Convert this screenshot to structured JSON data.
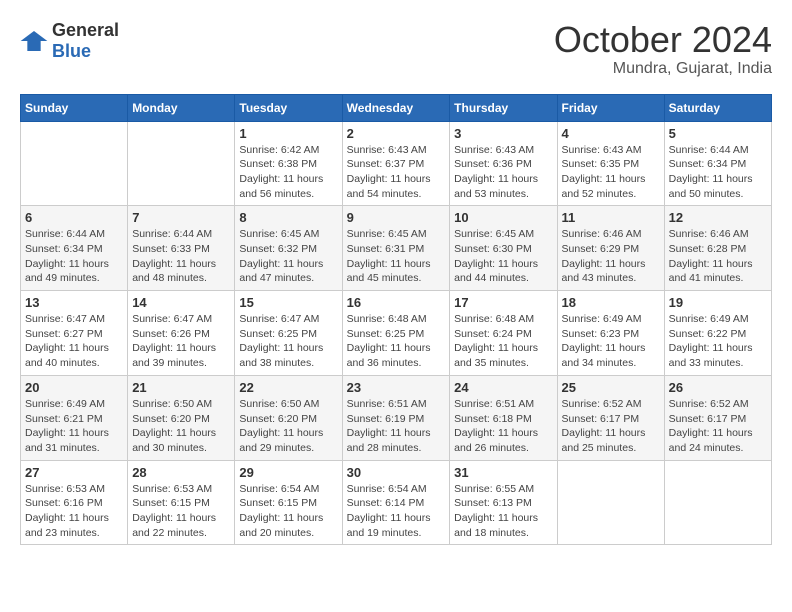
{
  "logo": {
    "general": "General",
    "blue": "Blue"
  },
  "title": "October 2024",
  "location": "Mundra, Gujarat, India",
  "headers": [
    "Sunday",
    "Monday",
    "Tuesday",
    "Wednesday",
    "Thursday",
    "Friday",
    "Saturday"
  ],
  "weeks": [
    [
      {
        "day": "",
        "info": ""
      },
      {
        "day": "",
        "info": ""
      },
      {
        "day": "1",
        "info": "Sunrise: 6:42 AM\nSunset: 6:38 PM\nDaylight: 11 hours and 56 minutes."
      },
      {
        "day": "2",
        "info": "Sunrise: 6:43 AM\nSunset: 6:37 PM\nDaylight: 11 hours and 54 minutes."
      },
      {
        "day": "3",
        "info": "Sunrise: 6:43 AM\nSunset: 6:36 PM\nDaylight: 11 hours and 53 minutes."
      },
      {
        "day": "4",
        "info": "Sunrise: 6:43 AM\nSunset: 6:35 PM\nDaylight: 11 hours and 52 minutes."
      },
      {
        "day": "5",
        "info": "Sunrise: 6:44 AM\nSunset: 6:34 PM\nDaylight: 11 hours and 50 minutes."
      }
    ],
    [
      {
        "day": "6",
        "info": "Sunrise: 6:44 AM\nSunset: 6:34 PM\nDaylight: 11 hours and 49 minutes."
      },
      {
        "day": "7",
        "info": "Sunrise: 6:44 AM\nSunset: 6:33 PM\nDaylight: 11 hours and 48 minutes."
      },
      {
        "day": "8",
        "info": "Sunrise: 6:45 AM\nSunset: 6:32 PM\nDaylight: 11 hours and 47 minutes."
      },
      {
        "day": "9",
        "info": "Sunrise: 6:45 AM\nSunset: 6:31 PM\nDaylight: 11 hours and 45 minutes."
      },
      {
        "day": "10",
        "info": "Sunrise: 6:45 AM\nSunset: 6:30 PM\nDaylight: 11 hours and 44 minutes."
      },
      {
        "day": "11",
        "info": "Sunrise: 6:46 AM\nSunset: 6:29 PM\nDaylight: 11 hours and 43 minutes."
      },
      {
        "day": "12",
        "info": "Sunrise: 6:46 AM\nSunset: 6:28 PM\nDaylight: 11 hours and 41 minutes."
      }
    ],
    [
      {
        "day": "13",
        "info": "Sunrise: 6:47 AM\nSunset: 6:27 PM\nDaylight: 11 hours and 40 minutes."
      },
      {
        "day": "14",
        "info": "Sunrise: 6:47 AM\nSunset: 6:26 PM\nDaylight: 11 hours and 39 minutes."
      },
      {
        "day": "15",
        "info": "Sunrise: 6:47 AM\nSunset: 6:25 PM\nDaylight: 11 hours and 38 minutes."
      },
      {
        "day": "16",
        "info": "Sunrise: 6:48 AM\nSunset: 6:25 PM\nDaylight: 11 hours and 36 minutes."
      },
      {
        "day": "17",
        "info": "Sunrise: 6:48 AM\nSunset: 6:24 PM\nDaylight: 11 hours and 35 minutes."
      },
      {
        "day": "18",
        "info": "Sunrise: 6:49 AM\nSunset: 6:23 PM\nDaylight: 11 hours and 34 minutes."
      },
      {
        "day": "19",
        "info": "Sunrise: 6:49 AM\nSunset: 6:22 PM\nDaylight: 11 hours and 33 minutes."
      }
    ],
    [
      {
        "day": "20",
        "info": "Sunrise: 6:49 AM\nSunset: 6:21 PM\nDaylight: 11 hours and 31 minutes."
      },
      {
        "day": "21",
        "info": "Sunrise: 6:50 AM\nSunset: 6:20 PM\nDaylight: 11 hours and 30 minutes."
      },
      {
        "day": "22",
        "info": "Sunrise: 6:50 AM\nSunset: 6:20 PM\nDaylight: 11 hours and 29 minutes."
      },
      {
        "day": "23",
        "info": "Sunrise: 6:51 AM\nSunset: 6:19 PM\nDaylight: 11 hours and 28 minutes."
      },
      {
        "day": "24",
        "info": "Sunrise: 6:51 AM\nSunset: 6:18 PM\nDaylight: 11 hours and 26 minutes."
      },
      {
        "day": "25",
        "info": "Sunrise: 6:52 AM\nSunset: 6:17 PM\nDaylight: 11 hours and 25 minutes."
      },
      {
        "day": "26",
        "info": "Sunrise: 6:52 AM\nSunset: 6:17 PM\nDaylight: 11 hours and 24 minutes."
      }
    ],
    [
      {
        "day": "27",
        "info": "Sunrise: 6:53 AM\nSunset: 6:16 PM\nDaylight: 11 hours and 23 minutes."
      },
      {
        "day": "28",
        "info": "Sunrise: 6:53 AM\nSunset: 6:15 PM\nDaylight: 11 hours and 22 minutes."
      },
      {
        "day": "29",
        "info": "Sunrise: 6:54 AM\nSunset: 6:15 PM\nDaylight: 11 hours and 20 minutes."
      },
      {
        "day": "30",
        "info": "Sunrise: 6:54 AM\nSunset: 6:14 PM\nDaylight: 11 hours and 19 minutes."
      },
      {
        "day": "31",
        "info": "Sunrise: 6:55 AM\nSunset: 6:13 PM\nDaylight: 11 hours and 18 minutes."
      },
      {
        "day": "",
        "info": ""
      },
      {
        "day": "",
        "info": ""
      }
    ]
  ]
}
